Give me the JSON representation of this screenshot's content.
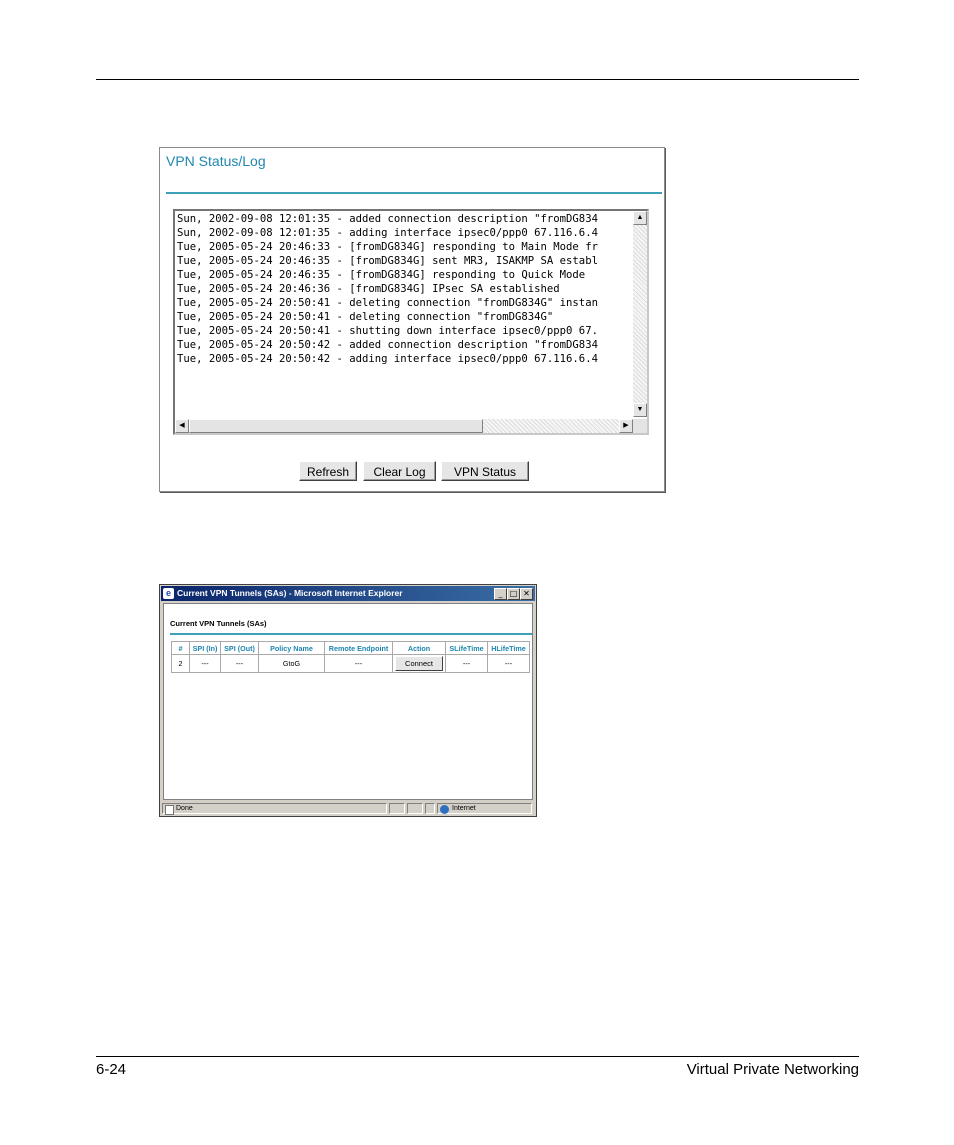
{
  "header": {},
  "vpn_log": {
    "title": "VPN Status/Log",
    "lines": [
      "Sun, 2002-09-08 12:01:35 - added connection description \"fromDG834",
      "Sun, 2002-09-08 12:01:35 - adding interface ipsec0/ppp0 67.116.6.4",
      "Tue, 2005-05-24 20:46:33 - [fromDG834G] responding to Main Mode fr",
      "Tue, 2005-05-24 20:46:35 - [fromDG834G] sent MR3, ISAKMP SA establ",
      "Tue, 2005-05-24 20:46:35 - [fromDG834G] responding to Quick Mode",
      "Tue, 2005-05-24 20:46:36 - [fromDG834G] IPsec SA established",
      "Tue, 2005-05-24 20:50:41 - deleting connection \"fromDG834G\" instan",
      "Tue, 2005-05-24 20:50:41 - deleting connection \"fromDG834G\"",
      "Tue, 2005-05-24 20:50:41 - shutting down interface ipsec0/ppp0 67.",
      "Tue, 2005-05-24 20:50:42 - added connection description \"fromDG834",
      "Tue, 2005-05-24 20:50:42 - adding interface ipsec0/ppp0 67.116.6.4"
    ],
    "buttons": {
      "refresh": "Refresh",
      "clear_log": "Clear Log",
      "vpn_status": "VPN Status"
    }
  },
  "ie_window": {
    "title": "Current VPN Tunnels (SAs) - Microsoft Internet Explorer",
    "heading": "Current VPN Tunnels (SAs)",
    "columns": [
      "#",
      "SPI (In)",
      "SPI (Out)",
      "Policy Name",
      "Remote Endpoint",
      "Action",
      "SLifeTime",
      "HLifeTime"
    ],
    "rows": [
      {
        "num": "2",
        "spi_in": "---",
        "spi_out": "---",
        "policy_name": "GtoG",
        "remote_endpoint": "---",
        "action": "Connect",
        "slifetime": "---",
        "hlifetime": "---"
      }
    ],
    "status_left": "Done",
    "status_zone": "Internet"
  },
  "footer": {
    "page_number": "6-24",
    "section_title": "Virtual Private Networking"
  },
  "colors": {
    "accent": "#1f86b0",
    "rule": "#3d9fb8",
    "ie_title": "#0a246a"
  }
}
